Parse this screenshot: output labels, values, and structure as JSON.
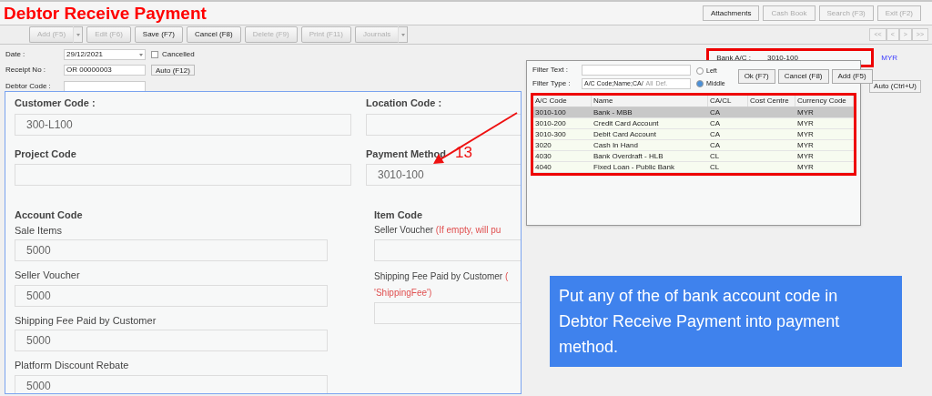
{
  "window": {
    "title": "Debtor Receive Payment"
  },
  "top_buttons": [
    {
      "label": "Attachments",
      "disabled": false
    },
    {
      "label": "Cash Book",
      "disabled": true
    },
    {
      "label": "Search (F3)",
      "disabled": true
    },
    {
      "label": "Exit (F2)",
      "disabled": true
    }
  ],
  "toolbar": [
    {
      "label": "Add (F5)",
      "disabled": true,
      "dropdown": true
    },
    {
      "label": "Edit (F6)",
      "disabled": true,
      "dropdown": false
    },
    {
      "label": "Save (F7)",
      "disabled": false,
      "dropdown": false
    },
    {
      "label": "Cancel (F8)",
      "disabled": false,
      "dropdown": false
    },
    {
      "label": "Delete (F9)",
      "disabled": true,
      "dropdown": false
    },
    {
      "label": "Print (F11)",
      "disabled": true,
      "dropdown": false
    },
    {
      "label": "Journals",
      "disabled": true,
      "dropdown": true
    }
  ],
  "nav_buttons": [
    "<<",
    "<",
    ">",
    ">>"
  ],
  "form": {
    "date_label": "Date :",
    "date": "29/12/2021",
    "cancelled_label": "Cancelled",
    "cancelled": false,
    "receipt_label": "Receipt No :",
    "receipt": "OR 00000003",
    "auto_button": "Auto (F12)",
    "debtor_label": "Debtor Code :"
  },
  "bank": {
    "label": "Bank A/C :",
    "value": "3010-100",
    "currency": "MYR",
    "auto_button": "Auto (Ctrl+U)"
  },
  "web_form": {
    "top": [
      {
        "label": "Customer Code :",
        "value": "300-L100"
      },
      {
        "label": "Location Code :"
      },
      {
        "label": "Project Code"
      },
      {
        "label": "Payment Method",
        "value": "3010-100"
      }
    ],
    "account_heading": "Account Code",
    "item_heading": "Item Code",
    "accounts": [
      {
        "label": "Sale Items",
        "value": "5000"
      },
      {
        "label": "Seller Voucher",
        "value": "5000"
      },
      {
        "label": "Shipping Fee Paid by Customer",
        "value": "5000"
      },
      {
        "label": "Platform Discount Rebate",
        "value": "5000"
      }
    ],
    "items": [
      {
        "label": "Seller Voucher",
        "note": "(If empty, will pu"
      },
      {
        "label": "Shipping Fee Paid by Customer",
        "note": "(",
        "note_continued": "'ShippingFee')"
      }
    ]
  },
  "lookup": {
    "filter_text_label": "Filter Text :",
    "filter_type_label": "Filter Type :",
    "filter_type": "A/C Code;Name;CA/",
    "all": "All",
    "def": "Def.",
    "radios": [
      {
        "label": "Left",
        "selected": false
      },
      {
        "label": "Middle",
        "selected": true
      }
    ],
    "buttons": [
      "Ok (F7)",
      "Cancel (F8)",
      "Add (F5)"
    ],
    "columns": [
      "A/C Code",
      "Name",
      "CA/CL",
      "Cost Centre",
      "Currency Code"
    ],
    "rows": [
      {
        "cells": [
          "3010-100",
          "Bank - MBB",
          "CA",
          "",
          "MYR"
        ],
        "selected": true
      },
      {
        "cells": [
          "3010-200",
          "Credit Card Account",
          "CA",
          "",
          "MYR"
        ],
        "selected": false
      },
      {
        "cells": [
          "3010-300",
          "Debit Card Account",
          "CA",
          "",
          "MYR"
        ],
        "selected": false
      },
      {
        "cells": [
          "3020",
          "Cash In Hand",
          "CA",
          "",
          "MYR"
        ],
        "selected": false
      },
      {
        "cells": [
          "4030",
          "Bank Overdraft - HLB",
          "CL",
          "",
          "MYR"
        ],
        "selected": false
      },
      {
        "cells": [
          "4040",
          "Fixed Loan - Public Bank",
          "CL",
          "",
          "MYR"
        ],
        "selected": false
      }
    ]
  },
  "annotation": {
    "number": "13",
    "callout": "Put any of the of bank account code in Debtor Receive Payment into payment method."
  }
}
